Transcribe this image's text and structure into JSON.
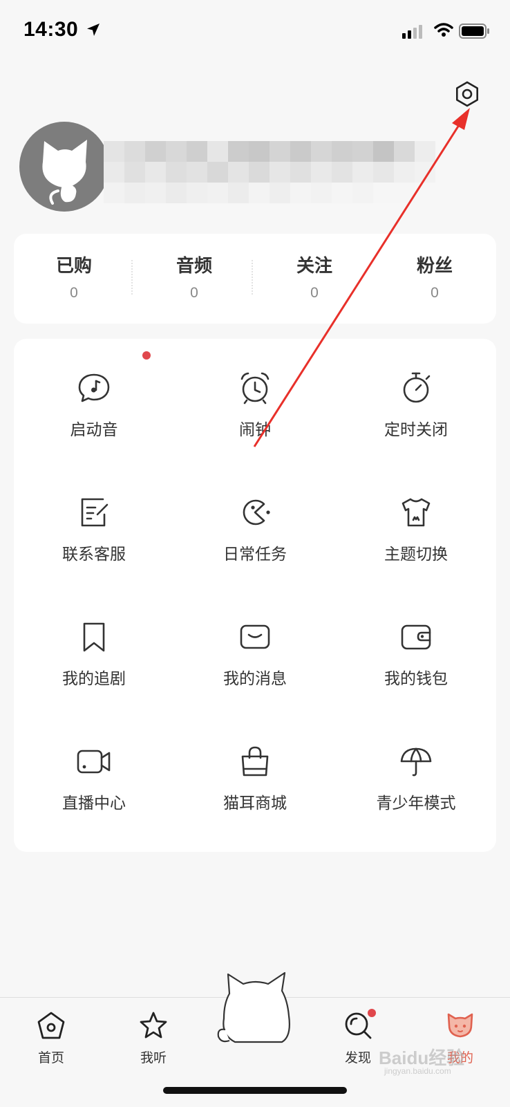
{
  "status_bar": {
    "time": "14:30"
  },
  "stats": [
    {
      "label": "已购",
      "value": "0"
    },
    {
      "label": "音频",
      "value": "0"
    },
    {
      "label": "关注",
      "value": "0"
    },
    {
      "label": "粉丝",
      "value": "0"
    }
  ],
  "grid": [
    {
      "label": "启动音",
      "icon": "music-bubble-icon",
      "badge": true
    },
    {
      "label": "闹钟",
      "icon": "alarm-clock-icon"
    },
    {
      "label": "定时关闭",
      "icon": "timer-icon"
    },
    {
      "label": "联系客服",
      "icon": "edit-note-icon"
    },
    {
      "label": "日常任务",
      "icon": "pacman-icon"
    },
    {
      "label": "主题切换",
      "icon": "tshirt-icon"
    },
    {
      "label": "我的追剧",
      "icon": "bookmark-icon"
    },
    {
      "label": "我的消息",
      "icon": "message-icon"
    },
    {
      "label": "我的钱包",
      "icon": "wallet-icon"
    },
    {
      "label": "直播中心",
      "icon": "video-camera-icon"
    },
    {
      "label": "猫耳商城",
      "icon": "shopping-bag-icon"
    },
    {
      "label": "青少年模式",
      "icon": "umbrella-icon"
    }
  ],
  "tabbar": [
    {
      "label": "首页",
      "icon": "home-icon"
    },
    {
      "label": "我听",
      "icon": "star-icon"
    },
    {
      "label": "发现",
      "icon": "discover-search-icon",
      "badge": true
    },
    {
      "label": "我的",
      "icon": "cat-face-icon",
      "active": true
    }
  ],
  "colors": {
    "accent": "#e0614f",
    "badge": "#e0474c",
    "annotation_arrow": "#e8302a"
  },
  "watermark": {
    "main": "Baidu经验",
    "sub": "jingyan.baidu.com"
  }
}
